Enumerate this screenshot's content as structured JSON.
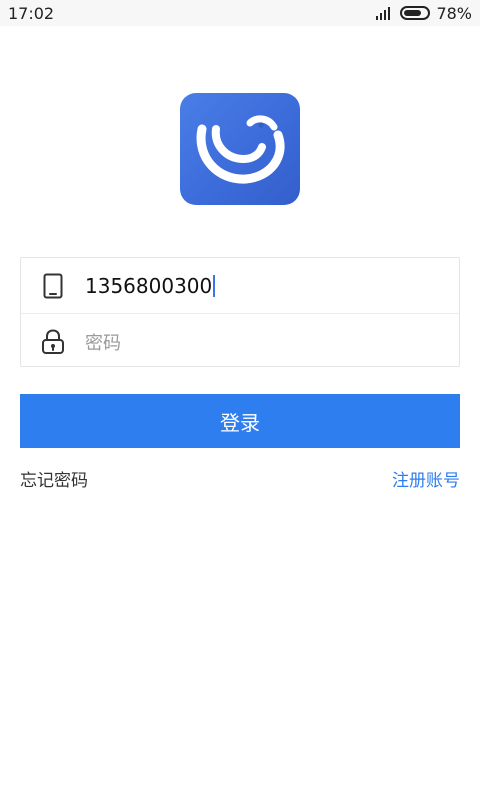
{
  "status_bar": {
    "time": "17:02",
    "battery_percent": "78%",
    "battery_level": 0.78,
    "signal_icon": "signal-icon",
    "battery_icon": "battery-icon"
  },
  "logo": {
    "icon": "app-logo-icon",
    "colors": {
      "background": "#4a7ee6",
      "glyph": "#ffffff"
    }
  },
  "form": {
    "phone": {
      "icon": "phone-icon",
      "value": "1356800300"
    },
    "password": {
      "icon": "lock-icon",
      "placeholder": "密码",
      "value": ""
    }
  },
  "actions": {
    "login_label": "登录",
    "forgot_password": "忘记密码",
    "register": "注册账号"
  },
  "colors": {
    "accent": "#2f7ef0",
    "border": "#e5e5e5"
  }
}
